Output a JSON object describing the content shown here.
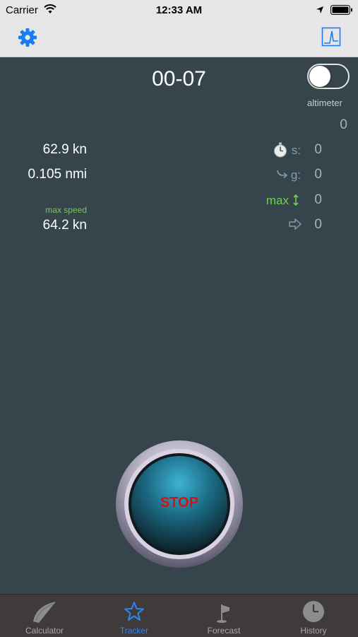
{
  "status": {
    "carrier": "Carrier",
    "time": "12:33 AM"
  },
  "tracker": {
    "timer": "00-07",
    "altimeter_label": "altimeter",
    "altimeter_value": "0",
    "altimeter_on": false,
    "speed": "62.9 kn",
    "distance": "0.105 nmi",
    "max_speed_label": "max speed",
    "max_speed": "64.2 kn",
    "stats": {
      "s_label": "s:",
      "s_value": "0",
      "g_label": "g:",
      "g_value": "0",
      "max_label": "max",
      "max_value": "0",
      "arrow_value": "0"
    },
    "stop_label": "STOP"
  },
  "tabs": [
    {
      "label": "Calculator",
      "icon": "glider-icon",
      "active": false
    },
    {
      "label": "Tracker",
      "icon": "star-icon",
      "active": true
    },
    {
      "label": "Forecast",
      "icon": "windsock-icon",
      "active": false
    },
    {
      "label": "History",
      "icon": "clock-icon",
      "active": false
    }
  ],
  "colors": {
    "background": "#36444c",
    "accent": "#2e86f0",
    "max_green": "#6fd14b",
    "stop_red": "#d21313"
  }
}
